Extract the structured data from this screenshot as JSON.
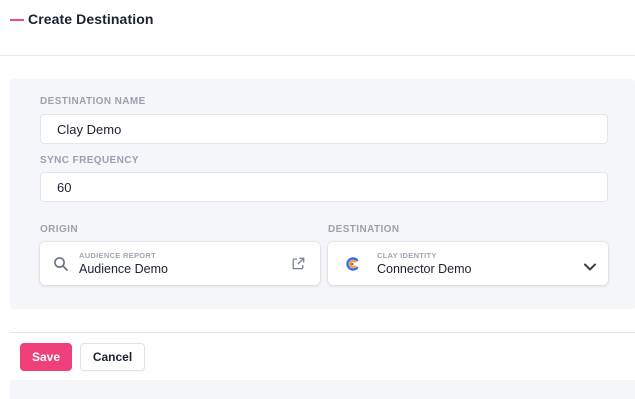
{
  "header": {
    "title": "Create Destination"
  },
  "form": {
    "destination_name": {
      "label": "DESTINATION NAME",
      "value": "Clay Demo"
    },
    "sync_frequency": {
      "label": "SYNC FREQUENCY",
      "value": "60"
    },
    "origin": {
      "label": "ORIGIN",
      "type_label": "AUDIENCE REPORT",
      "value": "Audience Demo",
      "icon": "search-icon",
      "action_icon": "external-link-icon"
    },
    "destination": {
      "label": "DESTINATION",
      "type_label": "CLAY IDENTITY",
      "value": "Connector Demo",
      "icon": "clay-logo-icon",
      "action_icon": "chevron-down-icon"
    }
  },
  "footer": {
    "save_label": "Save",
    "cancel_label": "Cancel"
  },
  "colors": {
    "accent": "#f0407a",
    "panel_bg": "#f5f6f9",
    "label": "#9aa0ad"
  }
}
